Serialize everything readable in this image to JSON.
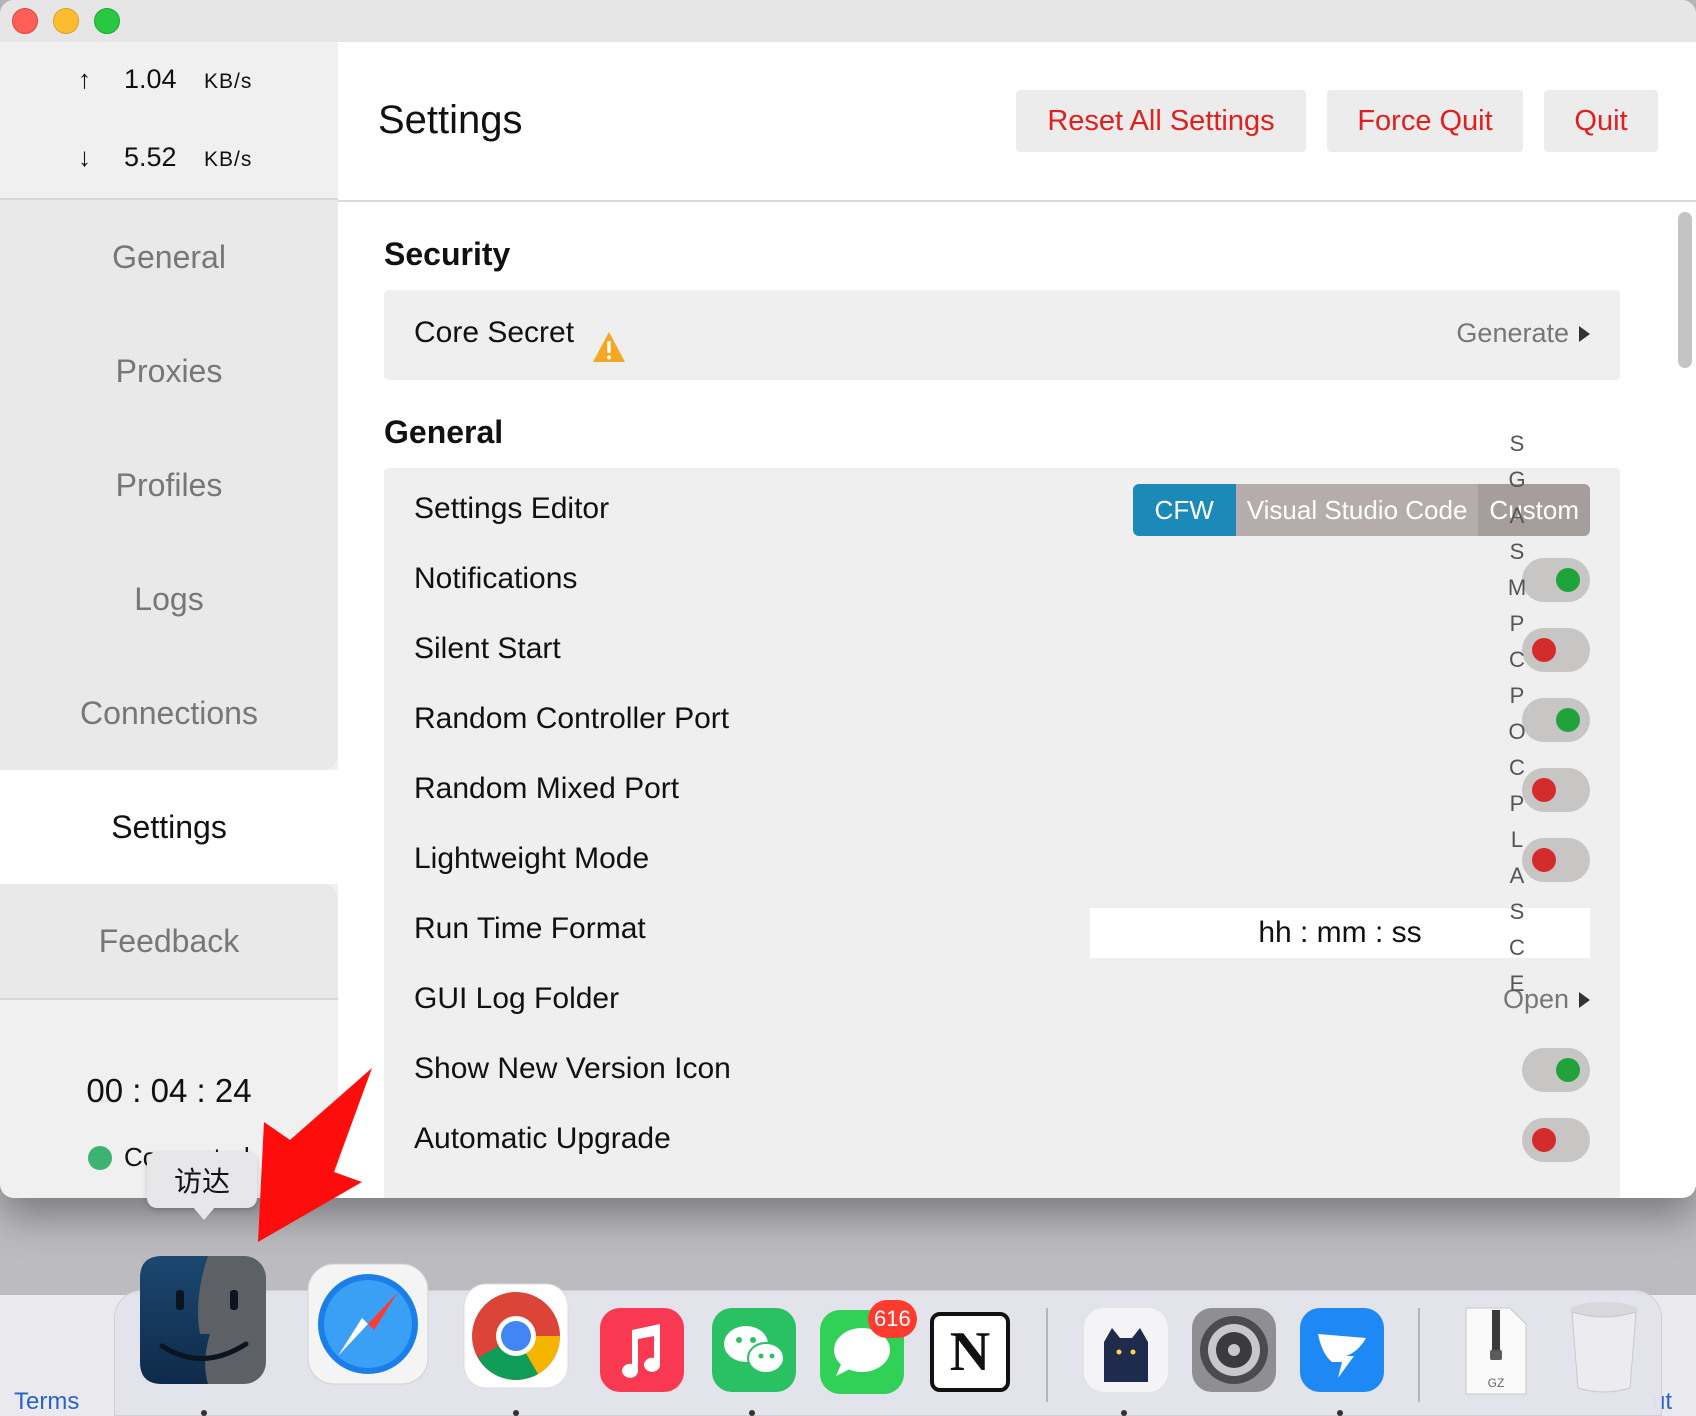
{
  "window": {
    "title": ""
  },
  "traffic": {
    "up_arrow": "↑",
    "up_value": "1.04",
    "up_unit": "KB/s",
    "down_arrow": "↓",
    "down_value": "5.52",
    "down_unit": "KB/s"
  },
  "nav": {
    "items": [
      {
        "label": "General"
      },
      {
        "label": "Proxies"
      },
      {
        "label": "Profiles"
      },
      {
        "label": "Logs"
      },
      {
        "label": "Connections"
      },
      {
        "label": "Settings",
        "active": true
      },
      {
        "label": "Feedback"
      }
    ]
  },
  "status": {
    "timer": "00 : 04 : 24",
    "connection": "Connected",
    "connection_color": "#3cb371"
  },
  "header": {
    "title": "Settings",
    "buttons": {
      "reset": "Reset All Settings",
      "force_quit": "Force Quit",
      "quit": "Quit"
    },
    "button_color": "#e0201e"
  },
  "security": {
    "title": "Security",
    "core_secret": {
      "label": "Core Secret",
      "icon": "warning-icon",
      "action": "Generate"
    }
  },
  "general": {
    "title": "General",
    "settings_editor": {
      "label": "Settings Editor",
      "options": [
        "CFW",
        "Visual Studio Code",
        "Custom"
      ],
      "selected": "CFW"
    },
    "notifications": {
      "label": "Notifications",
      "on": true
    },
    "silent_start": {
      "label": "Silent Start",
      "on": false
    },
    "random_controller_port": {
      "label": "Random Controller Port",
      "on": true
    },
    "random_mixed_port": {
      "label": "Random Mixed Port",
      "on": false
    },
    "lightweight_mode": {
      "label": "Lightweight Mode",
      "on": false
    },
    "run_time_format": {
      "label": "Run Time Format",
      "value": "hh : mm : ss"
    },
    "gui_log_folder": {
      "label": "GUI Log Folder",
      "action": "Open"
    },
    "show_new_version_icon": {
      "label": "Show New Version Icon",
      "on": true
    },
    "automatic_upgrade": {
      "label": "Automatic Upgrade",
      "on": false
    }
  },
  "colors": {
    "toggle_on": "#1fa33a",
    "toggle_off": "#d42c2c",
    "segment_selected": "#1c8ab9"
  },
  "index_letters": [
    "S",
    "G",
    "A",
    "S",
    "M",
    "P",
    "C",
    "P",
    "O",
    "C",
    "P",
    "L",
    "A",
    "S",
    "C",
    "E"
  ],
  "dock": {
    "tooltip": "访达",
    "apps": [
      {
        "name": "finder-icon"
      },
      {
        "name": "safari-icon"
      },
      {
        "name": "chrome-icon"
      },
      {
        "name": "music-icon"
      },
      {
        "name": "wechat-icon"
      },
      {
        "name": "messages-icon",
        "badge": "616"
      },
      {
        "name": "notion-icon",
        "letter": "N"
      },
      {
        "name": "clash-cat-icon"
      },
      {
        "name": "system-preferences-icon"
      },
      {
        "name": "dingtalk-icon"
      },
      {
        "name": "archive-file-icon",
        "label": "GZ"
      },
      {
        "name": "trash-icon"
      }
    ]
  },
  "desktop": {
    "left_text": "Terms",
    "right_text": "ut"
  }
}
